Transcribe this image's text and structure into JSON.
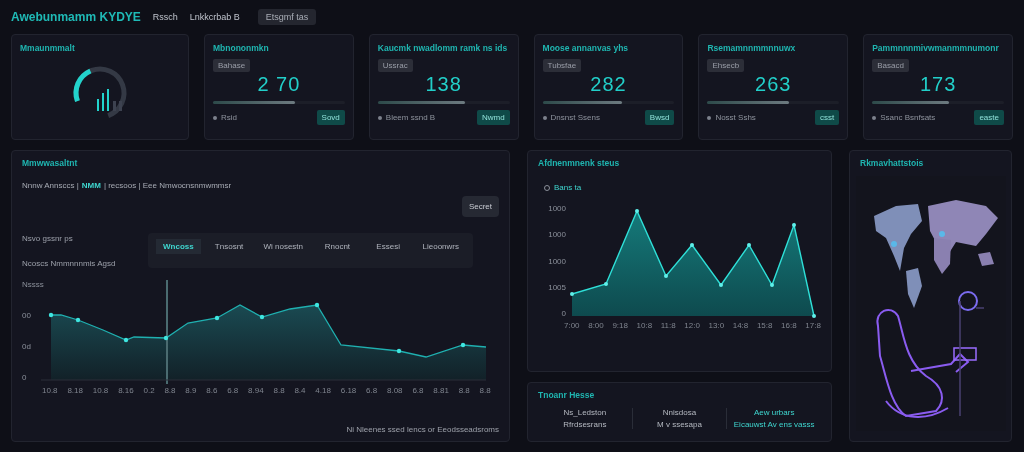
{
  "header": {
    "title": "Awebunmamm KYDYE",
    "nav": [
      "Rssch",
      "Lnkkcrbab B"
    ],
    "badge": "Etsgmf tas"
  },
  "cards": [
    {
      "kind": "gauge",
      "title": "Mmaunmmalt",
      "level": 0.32
    },
    {
      "kind": "stat",
      "title": "Mbnononmkn",
      "tag": "Bahase",
      "value": "2 70",
      "level": 0.62,
      "footer": "Rsid",
      "action": "Sovd"
    },
    {
      "kind": "stat",
      "title": "Kaucmk nwadlomm ramk ns ids",
      "tag": "Ussrac",
      "value": "138",
      "level": 0.66,
      "footer": "Bleem ssnd B",
      "action": "Nwmd"
    },
    {
      "kind": "stat",
      "title": "Moose annanvas yhs",
      "tag": "Tubsfae",
      "value": "282",
      "level": 0.6,
      "footer": "Dnsnst Ssens",
      "action": "Bwsd"
    },
    {
      "kind": "stat",
      "title": "Rsemamnnmmnnuwx",
      "tag": "Ehsecb",
      "value": "263",
      "level": 0.62,
      "footer": "Nosst Sshs",
      "action": "csst"
    },
    {
      "kind": "stat",
      "title": "Pammnnnmivwmanmmnumonr",
      "tag": "Basacd",
      "value": "173",
      "level": 0.58,
      "footer": "Ssanc Bsnfsats",
      "action": "easte"
    }
  ],
  "activity": {
    "title": "Mmwwasaltnt",
    "subtitle": [
      {
        "text": "Nnnw Annsccs |",
        "accent": false
      },
      {
        "text": "NMM",
        "accent": true
      },
      {
        "text": "| recsoos | Eee Nmwocnsnmwmmsr",
        "accent": false
      }
    ],
    "button": "Secret",
    "side_labels": [
      "Nsvo gssnr ps",
      "Ncoscs  Nmmnnnmis Agsd"
    ],
    "tabs": [
      {
        "label": "Wncoss",
        "selected": true
      },
      {
        "label": "Tnsosnt",
        "selected": false
      },
      {
        "label": "Wi nosestn",
        "selected": false
      },
      {
        "label": "Rnocnt",
        "selected": false
      },
      {
        "label": "Essesi",
        "selected": false
      },
      {
        "label": "Lieoonwrs",
        "selected": false
      }
    ],
    "y_labels": [
      "Nssss",
      "00",
      "0d",
      "0"
    ],
    "x_labels": [
      "10.8",
      "8.18",
      "10.8",
      "8.16",
      "0.2",
      "8.8",
      "8.9",
      "8.6",
      "6.8",
      "8.94",
      "8.8",
      "8.4",
      "4.18",
      "6.18",
      "6.8",
      "8.08",
      "6.8",
      "8.81",
      "8.8",
      "8.8"
    ],
    "footer": "Ni Nleenes ssed lencs or Eeodsseadsroms"
  },
  "trend": {
    "title": "Afdnenmnenk steus",
    "legend": "Bans ta",
    "y_labels": [
      "1000",
      "1000",
      "1000",
      "1005",
      "0"
    ],
    "x_labels": [
      "7:00",
      "8:00",
      "9:18",
      "10:8",
      "11:8",
      "12:0",
      "13:0",
      "14:8",
      "15:8",
      "16:8",
      "17:8"
    ]
  },
  "info": {
    "title": "Tnoanr Hesse",
    "columns": [
      {
        "lines": [
          {
            "text": "Ns_Ledston",
            "accent": false
          },
          {
            "text": "Rfrdsesrans",
            "accent": false
          }
        ]
      },
      {
        "lines": [
          {
            "text": "Nnisdosa",
            "accent": false
          },
          {
            "text": "M v ssesapa",
            "accent": false
          }
        ]
      },
      {
        "lines": [
          {
            "text": "Aew urbars",
            "accent": true
          },
          {
            "text": "Eicauwst Av ens vasss",
            "accent": true
          }
        ]
      }
    ]
  },
  "visual": {
    "title": "Rkmavhattstois",
    "kind": "picture"
  }
}
